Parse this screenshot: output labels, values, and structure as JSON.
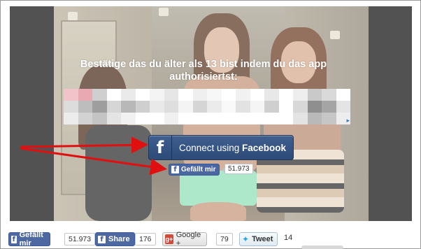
{
  "overlay": {
    "headline_line1": "Bestätige das du älter als 13 bist indem du das app",
    "headline_line2": "authorisiertst:"
  },
  "ad": {
    "adchoices_icon": "adchoices-icon",
    "mosaic_colors": [
      "#f2c3c8",
      "#e9a9b2",
      "#cfcfcf",
      "#ffffff",
      "#eaeaea",
      "#ffffff",
      "#f4f4f4",
      "#e6e6e6",
      "#ffffff",
      "#efefef",
      "#f7f7f7",
      "#ffffff",
      "#f1f1f1",
      "#ffffff",
      "#e8e8e8",
      "#ffffff",
      "#eeeeee",
      "#c9c9c9",
      "#d9d9d9",
      "#ffffff",
      "#dcdcdc",
      "#bdbdbd",
      "#9e9e9e",
      "#d6d6d6",
      "#b8b8b8",
      "#cfcfcf",
      "#e9e9e9",
      "#dedede",
      "#f4f4f4",
      "#d5d5d5",
      "#ebebeb",
      "#f9f9f9",
      "#e2e2e2",
      "#f5f5f5",
      "#cfcfcf",
      "#ffffff",
      "#d8d8d8",
      "#8f8f8f",
      "#a5a5a5",
      "#e4e4e4",
      "#ececec",
      "#d2d2d2",
      "#c4c4c4",
      "#e4e4e4",
      "#f1f1f1",
      "#ffffff",
      "#ffffff",
      "#f0f0f0",
      "#ffffff",
      "#ffffff",
      "#ffffff",
      "#ffffff",
      "#ffffff",
      "#ffffff",
      "#ffffff",
      "#ffffff",
      "#e3e3e3",
      "#b9b9b9",
      "#c6c6c6",
      "#ededed"
    ]
  },
  "connect": {
    "icon": "facebook-f-icon",
    "label_prefix": "Connect using ",
    "label_brand": "Facebook"
  },
  "inline_like": {
    "label": "Gefällt mir",
    "count": "51.973",
    "icon": "facebook-f-icon"
  },
  "share_bar": {
    "fb_like_label": "Gefällt mir",
    "fb_like_count": "51.973",
    "fb_share_label": "Share",
    "fb_share_count": "176",
    "gplus_label": "Google +",
    "gplus_count": "79",
    "tweet_label": "Tweet",
    "tweet_count": "14"
  },
  "colors": {
    "facebook_blue": "#3b5998",
    "arrow_red": "#e01010",
    "video_frame": "#525252"
  }
}
